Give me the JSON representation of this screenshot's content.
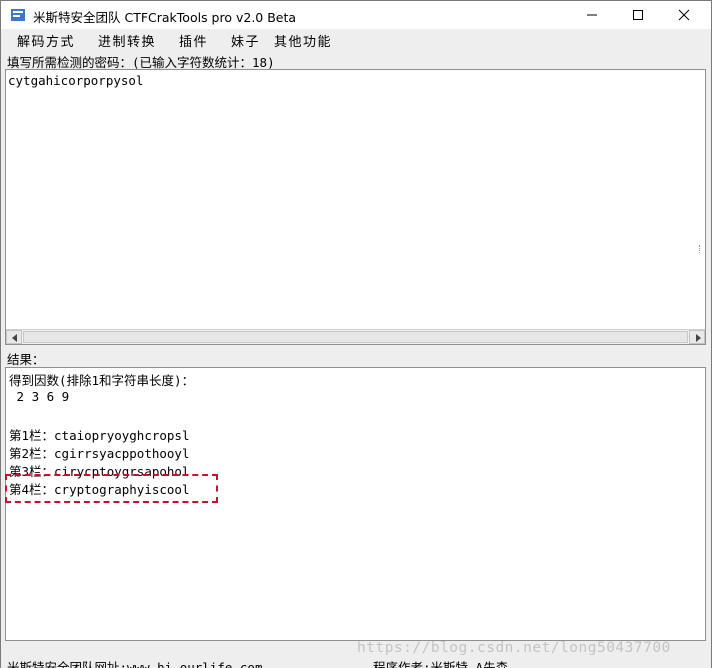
{
  "window": {
    "title": "米斯特安全团队 CTFCrakTools pro v2.0 Beta",
    "icons": {
      "app": "app-icon",
      "minimize": "minimize-icon",
      "maximize": "maximize-icon",
      "close": "close-icon"
    }
  },
  "menu": [
    "解码方式",
    "进制转换",
    "插件",
    "妹子",
    "其他功能"
  ],
  "input_section": {
    "label": "填写所需检测的密码：(已输入字符数统计：18)",
    "value": "cytgahicorporpysol"
  },
  "result_section": {
    "label": "结果：",
    "factors_heading": "得到因数(排除1和字符串长度)：",
    "factors": " 2 3 6 9",
    "rails": [
      "第1栏：ctaiopryoyghcropsl",
      "第2栏：cgirrsyacppothooyl",
      "第3栏：cirycptoygrsapohol",
      "第4栏：cryptographyiscool"
    ]
  },
  "status_bar": {
    "site": "米斯特安全团队网址:www.hi-ourlife.com",
    "author": "程序作者:米斯特 A先森"
  },
  "watermark": "https://blog.csdn.net/long50437700",
  "colors": {
    "highlight": "#c8102e",
    "background": "#eeeeee",
    "text_area": "#ffffff"
  }
}
